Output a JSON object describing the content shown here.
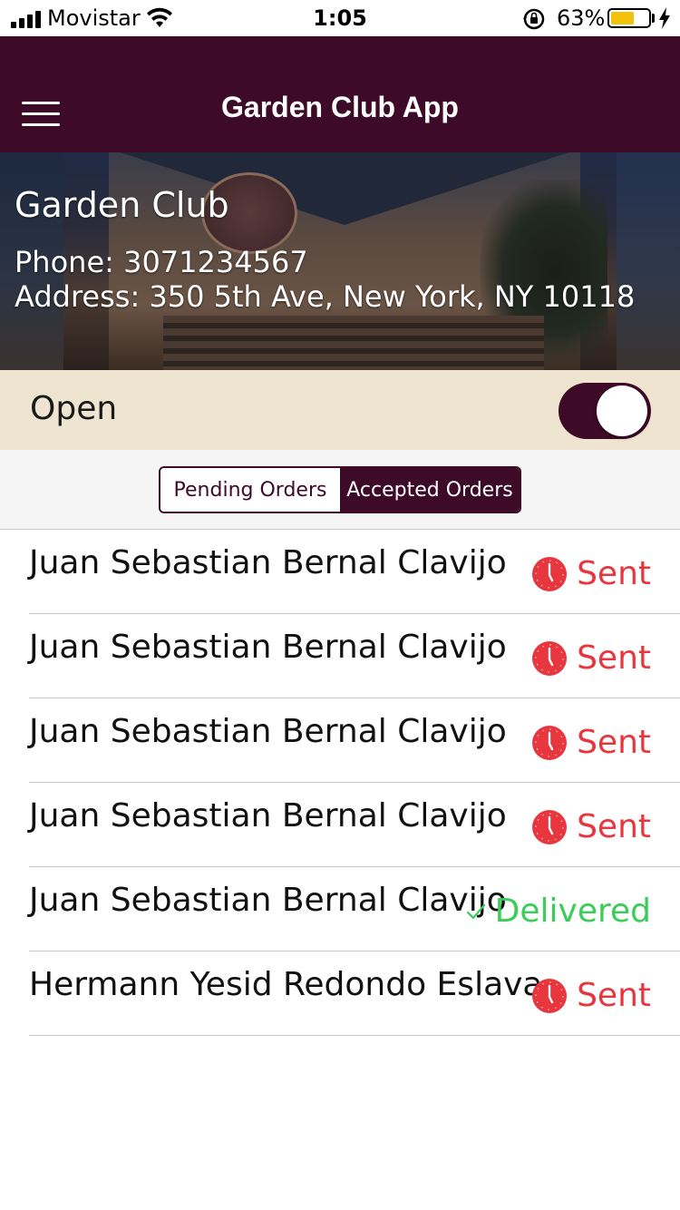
{
  "status_bar": {
    "carrier": "Movistar",
    "time": "1:05",
    "battery_percent": "63%",
    "battery_level": 0.63,
    "battery_color": "#f4c20d"
  },
  "nav": {
    "title": "Garden Club App",
    "menu_icon": "hamburger-menu-icon",
    "background_color": "#3d0a28"
  },
  "venue": {
    "name": "Garden Club",
    "phone": "Phone: 3071234567",
    "address": "Address: 350 5th Ave, New York, NY 10118"
  },
  "open_status": {
    "label": "Open",
    "toggle_on": true,
    "background_color": "#efe4cf"
  },
  "tabs": [
    {
      "label": "Pending Orders",
      "active": false
    },
    {
      "label": "Accepted Orders",
      "active": true
    }
  ],
  "orders": [
    {
      "customer": "Juan Sebastian Bernal Clavijo",
      "status": "Sent",
      "status_type": "sent",
      "icon": "clock-icon"
    },
    {
      "customer": "Juan Sebastian Bernal Clavijo",
      "status": "Sent",
      "status_type": "sent",
      "icon": "clock-icon"
    },
    {
      "customer": "Juan Sebastian Bernal Clavijo",
      "status": "Sent",
      "status_type": "sent",
      "icon": "clock-icon"
    },
    {
      "customer": "Juan Sebastian Bernal Clavijo",
      "status": "Sent",
      "status_type": "sent",
      "icon": "clock-icon"
    },
    {
      "customer": "Juan Sebastian Bernal Clavijo",
      "status": "Delivered",
      "status_type": "delivered",
      "icon": "checkmark-icon"
    },
    {
      "customer": "Hermann Yesid Redondo Eslava",
      "status": "Sent",
      "status_type": "sent",
      "icon": "clock-icon"
    }
  ],
  "colors": {
    "sent": "#e8363f",
    "delivered": "#3ccc5a",
    "brand": "#3d0a28"
  }
}
